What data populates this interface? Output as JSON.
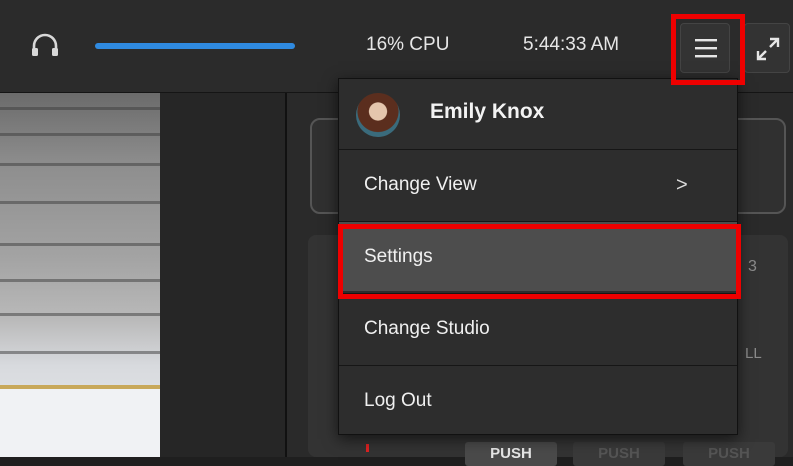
{
  "topbar": {
    "headphones_icon": "headphones-icon",
    "volume_level": 1.0,
    "cpu": "16% CPU",
    "time": "5:44:33 AM",
    "menu_icon": "hamburger-icon",
    "expand_icon": "expand-icon"
  },
  "colors": {
    "accent_blue": "#2f8ae0",
    "highlight_red": "#ee0000",
    "menu_bg": "#2d2d2d",
    "menu_active_bg": "#4d4d4d"
  },
  "dropdown": {
    "user_name": "Emily Knox",
    "items": [
      {
        "label": "Change View",
        "chevron": ">"
      },
      {
        "label": "Settings"
      },
      {
        "label": "Change Studio"
      },
      {
        "label": "Log Out"
      }
    ]
  },
  "right_panel": {
    "badge_number": "3",
    "partial_label": "LL",
    "push_labels": [
      "PUSH",
      "PUSH",
      "PUSH"
    ]
  }
}
